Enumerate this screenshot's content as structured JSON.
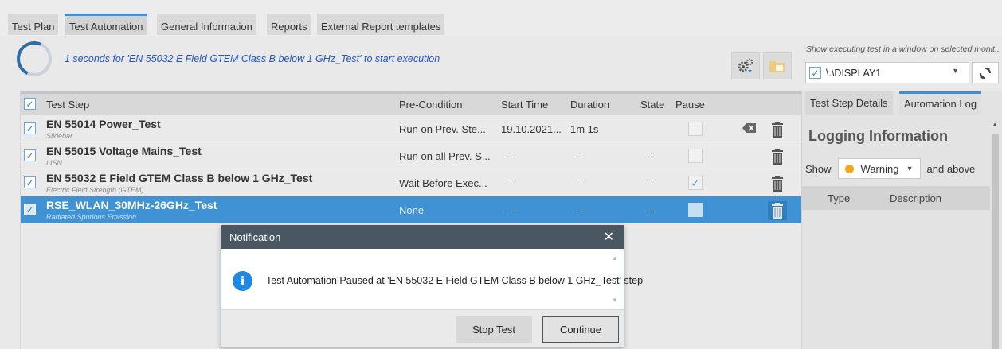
{
  "top_tabs": [
    {
      "label": "Test Plan",
      "active": false
    },
    {
      "label": "Test Automation",
      "active": true
    },
    {
      "label": "General Information",
      "active": false
    },
    {
      "label": "Reports",
      "active": false
    },
    {
      "label": "External Report templates",
      "active": false
    }
  ],
  "status": {
    "message": "1 seconds for 'EN 55032 E Field GTEM Class B  below 1 GHz_Test' to start execution",
    "color": "#2255c8"
  },
  "display": {
    "caption": "Show executing test in a window on selected monit...",
    "selected": "\\.\\DISPLAY1",
    "checked": true
  },
  "table": {
    "headers": {
      "test_step": "Test Step",
      "pre_condition": "Pre-Condition",
      "start_time": "Start Time",
      "duration": "Duration",
      "state": "State",
      "pause": "Pause"
    },
    "rows": [
      {
        "name": "EN 55014 Power_Test",
        "sub": "Slidebar",
        "pre": "Run on Prev. Ste...",
        "start": "19.10.2021...",
        "duration": "1m 1s",
        "state": "",
        "pause": false,
        "selected": false
      },
      {
        "name": "EN 55015 Voltage Mains_Test",
        "sub": "LISN",
        "pre": "Run on all Prev. S...",
        "start": "--",
        "duration": "--",
        "state": "--",
        "pause": false,
        "selected": false
      },
      {
        "name": "EN 55032 E Field GTEM Class B  below 1 GHz_Test",
        "sub": "Electric Field Strength (GTEM)",
        "pre": "Wait Before Exec...",
        "start": "--",
        "duration": "--",
        "state": "--",
        "pause": true,
        "selected": false
      },
      {
        "name": "RSE_WLAN_30MHz-26GHz_Test",
        "sub": "Radiated Spurious Emission",
        "pre": "None",
        "start": "--",
        "duration": "--",
        "state": "--",
        "pause": false,
        "selected": true
      }
    ]
  },
  "right_pane": {
    "tabs": [
      {
        "label": "Test Step Details",
        "active": false
      },
      {
        "label": "Automation Log",
        "active": true
      }
    ],
    "title": "Logging Information",
    "show_label": "Show",
    "level": "Warning",
    "level_color": "#f2a81d",
    "and_above": "and above",
    "columns": {
      "type": "Type",
      "description": "Description"
    }
  },
  "dialog": {
    "title": "Notification",
    "close": "✕",
    "message": "Test Automation Paused at 'EN 55032 E Field GTEM Class B  below 1 GHz_Test' step",
    "stop_label": "Stop Test",
    "continue_label": "Continue"
  }
}
